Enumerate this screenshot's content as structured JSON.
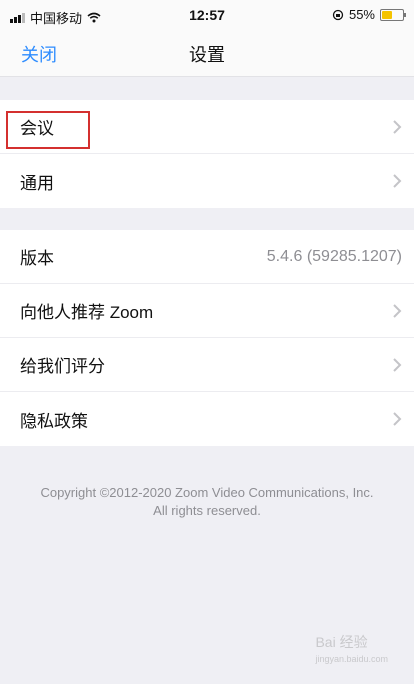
{
  "status_bar": {
    "carrier": "中国移动",
    "time": "12:57",
    "battery": "55%",
    "battery_level": 0.55
  },
  "nav": {
    "close_label": "关闭",
    "title": "设置"
  },
  "group1": [
    {
      "label": "会议"
    },
    {
      "label": "通用"
    }
  ],
  "group2": [
    {
      "label": "版本",
      "value": "5.4.6 (59285.1207)"
    },
    {
      "label": "向他人推荐 Zoom"
    },
    {
      "label": "给我们评分"
    },
    {
      "label": "隐私政策"
    }
  ],
  "copyright": {
    "line1": "Copyright ©2012-2020 Zoom Video Communications, Inc.",
    "line2": "All rights reserved."
  },
  "watermark": {
    "brand": "Bai 经验",
    "url": "jingyan.baidu.com"
  },
  "colors": {
    "accent": "#2d8cff",
    "highlight": "#d4302f",
    "battery": "#f4c300"
  },
  "icons": [
    "signal-icon",
    "wifi-icon",
    "lock-rotation-icon",
    "battery-icon",
    "chevron-right-icon"
  ]
}
